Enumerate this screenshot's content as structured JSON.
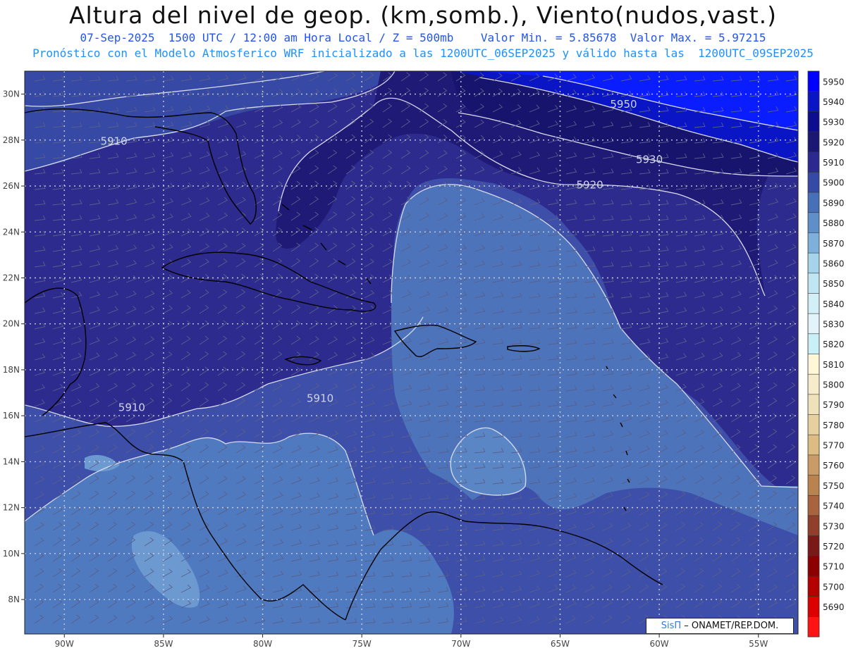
{
  "header": {
    "title": "Altura del nivel de geop. (km,somb.), Viento(nudos,vast.)",
    "line1": "07-Sep-2025  1500 UTC / 12:00 am Hora Local / Z = 500mb    Valor Min. = 5.85678  Valor Max. = 5.97215",
    "line2": "Pronóstico con el Modelo Atmosferico WRF inicializado a las 1200UTC_06SEP2025 y válido hasta las  1200UTC_09SEP2025"
  },
  "map": {
    "lon_range": [
      -92,
      -53
    ],
    "lat_range": [
      6.5,
      31
    ],
    "lon_ticks": [
      {
        "v": -90,
        "label": "90W"
      },
      {
        "v": -85,
        "label": "85W"
      },
      {
        "v": -80,
        "label": "80W"
      },
      {
        "v": -75,
        "label": "75W"
      },
      {
        "v": -70,
        "label": "70W"
      },
      {
        "v": -65,
        "label": "65W"
      },
      {
        "v": -60,
        "label": "60W"
      },
      {
        "v": -55,
        "label": "55W"
      }
    ],
    "lat_ticks": [
      {
        "v": 8,
        "label": "8N"
      },
      {
        "v": 10,
        "label": "10N"
      },
      {
        "v": 12,
        "label": "12N"
      },
      {
        "v": 14,
        "label": "14N"
      },
      {
        "v": 16,
        "label": "16N"
      },
      {
        "v": 18,
        "label": "18N"
      },
      {
        "v": 20,
        "label": "20N"
      },
      {
        "v": 22,
        "label": "22N"
      },
      {
        "v": 24,
        "label": "24N"
      },
      {
        "v": 26,
        "label": "26N"
      },
      {
        "v": 28,
        "label": "28N"
      },
      {
        "v": 30,
        "label": "30N"
      }
    ],
    "contour_labels": [
      {
        "text": "5950",
        "lon": -61.8,
        "lat": 29.4
      },
      {
        "text": "5930",
        "lon": -60.5,
        "lat": 27.0
      },
      {
        "text": "5920",
        "lon": -63.5,
        "lat": 25.9
      },
      {
        "text": "5910",
        "lon": -87.5,
        "lat": 27.8
      },
      {
        "text": "5910",
        "lon": -77.1,
        "lat": 16.6
      },
      {
        "text": "5910",
        "lon": -86.6,
        "lat": 16.2
      }
    ],
    "fill_colors": {
      "5950": "#0a1dff",
      "5940": "#0a16c6",
      "5930": "#1b1873",
      "5920": "#2a2590",
      "5910": "#3647a3",
      "5900": "#4a6fbb",
      "5890": "#6394c9"
    }
  },
  "colorbar": {
    "levels": [
      "5950",
      "5940",
      "5930",
      "5920",
      "5910",
      "5900",
      "5890",
      "5880",
      "5870",
      "5860",
      "5850",
      "5840",
      "5830",
      "5820",
      "5810",
      "5800",
      "5790",
      "5780",
      "5770",
      "5760",
      "5750",
      "5740",
      "5730",
      "5720",
      "5710",
      "5700",
      "5690"
    ],
    "colors": [
      "#0000ff",
      "#0a16c6",
      "#0d0e8f",
      "#1b1873",
      "#2d2a8f",
      "#3649a4",
      "#4870b8",
      "#5f8fc8",
      "#7fb0dc",
      "#a6d3ea",
      "#bfe6f2",
      "#d2eef6",
      "#e2f4fa",
      "#c8f0f6",
      "#fff7d8",
      "#f6eccb",
      "#efe2ba",
      "#e6d0a0",
      "#dcbc82",
      "#c99b66",
      "#b98350",
      "#a8643e",
      "#8f3f2c",
      "#7a1a18",
      "#8c0000",
      "#b50000",
      "#dd0000",
      "#ff1414"
    ]
  },
  "credit": {
    "brand": "SisΠ",
    "org": " – ONAMET/REP.DOM."
  }
}
